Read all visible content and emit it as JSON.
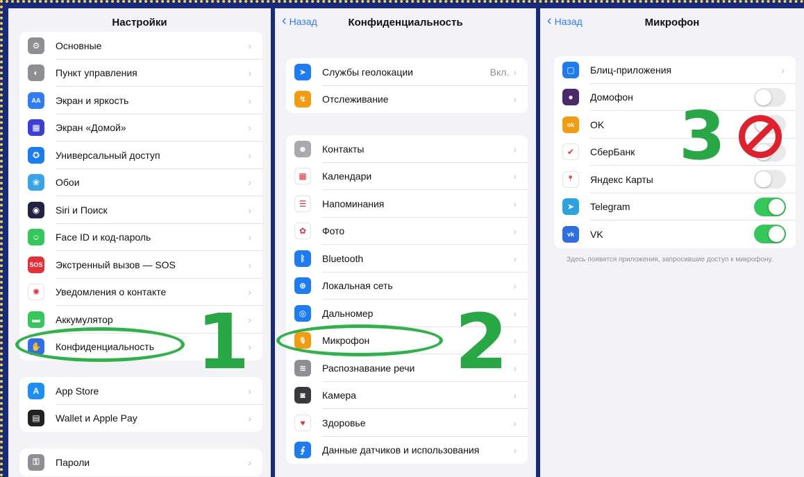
{
  "panel1": {
    "title": "Настройки",
    "group1": [
      {
        "icon": "gear-icon",
        "label": "Основные",
        "color": "#8e8e93",
        "glyph": "⚙"
      },
      {
        "icon": "control-center-icon",
        "label": "Пункт управления",
        "color": "#8e8e93",
        "glyph": "◐"
      },
      {
        "icon": "display-icon",
        "label": "Экран и яркость",
        "color": "#2f7cf6",
        "glyph": "AA"
      },
      {
        "icon": "home-screen-icon",
        "label": "Экран «Домой»",
        "color": "#3b3fd6",
        "glyph": "▦"
      },
      {
        "icon": "accessibility-icon",
        "label": "Универсальный доступ",
        "color": "#1b7cf2",
        "glyph": "✪"
      },
      {
        "icon": "wallpaper-icon",
        "label": "Обои",
        "color": "#36a6e8",
        "glyph": "❀"
      },
      {
        "icon": "siri-icon",
        "label": "Siri и Поиск",
        "color": "#222244",
        "glyph": "◉"
      },
      {
        "icon": "faceid-icon",
        "label": "Face ID и код-пароль",
        "color": "#34c759",
        "glyph": "☺"
      },
      {
        "icon": "sos-icon",
        "label": "Экстренный вызов — SOS",
        "color": "#e5303a",
        "glyph": "SOS"
      },
      {
        "icon": "exposure-icon",
        "label": "Уведомления о контакте",
        "color": "#ffffff",
        "glyph": "✺"
      },
      {
        "icon": "battery-icon",
        "label": "Аккумулятор",
        "color": "#34c759",
        "glyph": "▬"
      },
      {
        "icon": "privacy-hand-icon",
        "label": "Конфиденциальность",
        "color": "#2f6cf0",
        "glyph": "✋"
      }
    ],
    "group2": [
      {
        "icon": "app-store-icon",
        "label": "App Store",
        "color": "#1e8ef7",
        "glyph": "A"
      },
      {
        "icon": "wallet-icon",
        "label": "Wallet и Apple Pay",
        "color": "#222222",
        "glyph": "▤"
      }
    ],
    "group3": [
      {
        "icon": "key-icon",
        "label": "Пароли",
        "color": "#8e8e93",
        "glyph": "⚿"
      }
    ]
  },
  "panel2": {
    "back": "Назад",
    "title": "Конфиденциальность",
    "group1": [
      {
        "icon": "location-icon",
        "label": "Службы геолокации",
        "value": "Вкл.",
        "color": "#1e7cf2",
        "glyph": "➤"
      },
      {
        "icon": "tracking-icon",
        "label": "Отслеживание",
        "value": "",
        "color": "#f39c12",
        "glyph": "↯"
      }
    ],
    "group2": [
      {
        "icon": "contacts-icon",
        "label": "Контакты",
        "color": "#a9a9ae",
        "glyph": "☻"
      },
      {
        "icon": "calendar-icon",
        "label": "Календари",
        "color": "#ffffff",
        "glyph": "▦"
      },
      {
        "icon": "reminders-icon",
        "label": "Напоминания",
        "color": "#ffffff",
        "glyph": "☰"
      },
      {
        "icon": "photos-icon",
        "label": "Фото",
        "color": "#ffffff",
        "glyph": "✿"
      },
      {
        "icon": "bluetooth-icon",
        "label": "Bluetooth",
        "color": "#1e7cf2",
        "glyph": "ᛒ"
      },
      {
        "icon": "local-network-icon",
        "label": "Локальная сеть",
        "color": "#1e7cf2",
        "glyph": "⊕"
      },
      {
        "icon": "rangefinder-icon",
        "label": "Дальномер",
        "color": "#1e7cf2",
        "glyph": "◎"
      },
      {
        "icon": "microphone-icon",
        "label": "Микрофон",
        "color": "#f39c12",
        "glyph": "🎙"
      },
      {
        "icon": "speech-recognition-icon",
        "label": "Распознавание речи",
        "color": "#8e8e93",
        "glyph": "≋"
      },
      {
        "icon": "camera-icon",
        "label": "Камера",
        "color": "#3a3a3c",
        "glyph": "◙"
      },
      {
        "icon": "health-icon",
        "label": "Здоровье",
        "color": "#ffffff",
        "glyph": "♥"
      },
      {
        "icon": "sensor-data-icon",
        "label": "Данные датчиков и использования",
        "color": "#1e7cf2",
        "glyph": "∮"
      }
    ]
  },
  "panel3": {
    "back": "Назад",
    "title": "Микрофон",
    "apps": [
      {
        "icon": "app-clips-icon",
        "label": "Блиц-приложения",
        "type": "chevron",
        "color": "#1e7cf2",
        "glyph": "▢"
      },
      {
        "icon": "domofon-icon",
        "label": "Домофон",
        "type": "off",
        "color": "#4a2a6a",
        "glyph": "●"
      },
      {
        "icon": "ok-icon",
        "label": "OK",
        "type": "off",
        "color": "#f39c12",
        "glyph": "ok"
      },
      {
        "icon": "sberbank-icon",
        "label": "СберБанк",
        "type": "off",
        "color": "#ffffff",
        "glyph": "✔"
      },
      {
        "icon": "yandex-maps-icon",
        "label": "Яндекс Карты",
        "type": "off",
        "color": "#ffffff",
        "glyph": "📍"
      },
      {
        "icon": "telegram-icon",
        "label": "Telegram",
        "type": "on",
        "color": "#2aa3e0",
        "glyph": "➤"
      },
      {
        "icon": "vk-icon",
        "label": "VK",
        "type": "on",
        "color": "#2d6fe0",
        "glyph": "vk"
      }
    ],
    "footer": "Здесь появятся приложения, запросившие доступ к микрофону."
  },
  "annotations": {
    "step1": "1",
    "step2": "2",
    "step3": "3",
    "highlight_color": "#2db34a",
    "forbidden_color": "#e0202a"
  }
}
